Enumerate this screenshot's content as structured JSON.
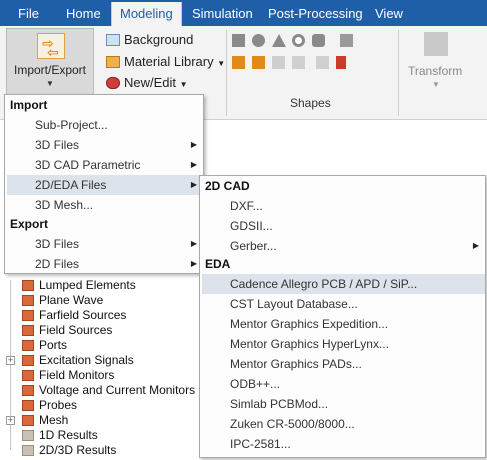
{
  "ribbon_tabs": [
    "File",
    "Home",
    "Modeling",
    "Simulation",
    "Post-Processing",
    "View"
  ],
  "ribbon": {
    "import_export_label": "Import/Export",
    "background_label": "Background",
    "material_library_label": "Material Library",
    "new_edit_label": "New/Edit",
    "shapes_group_label": "Shapes",
    "transform_label": "Transform"
  },
  "tree_items": [
    "Lumped Elements",
    "Plane Wave",
    "Farfield Sources",
    "Field Sources",
    "Ports",
    "Excitation Signals",
    "Field Monitors",
    "Voltage and Current Monitors",
    "Probes",
    "Mesh",
    "1D Results",
    "2D/3D Results"
  ],
  "import_export_menu": {
    "import_header": "Import",
    "import_items": [
      "Sub-Project...",
      "3D Files",
      "3D CAD Parametric",
      "2D/EDA Files",
      "3D Mesh..."
    ],
    "export_header": "Export",
    "export_items": [
      "3D Files",
      "2D Files"
    ]
  },
  "eda_submenu": {
    "cad_header": "2D CAD",
    "cad_items": [
      "DXF...",
      "GDSII...",
      "Gerber..."
    ],
    "eda_header": "EDA",
    "eda_items": [
      "Cadence Allegro PCB / APD / SiP...",
      "CST Layout Database...",
      "Mentor Graphics Expedition...",
      "Mentor Graphics HyperLynx...",
      "Mentor Graphics PADs...",
      "ODB++...",
      "Simlab PCBMod...",
      "Zuken CR-5000/8000...",
      "IPC-2581..."
    ]
  },
  "colors": {
    "tab_bar": "#1f5fa8",
    "menu_highlight": "#dde3ea",
    "icon_orange": "#e08a1c"
  }
}
